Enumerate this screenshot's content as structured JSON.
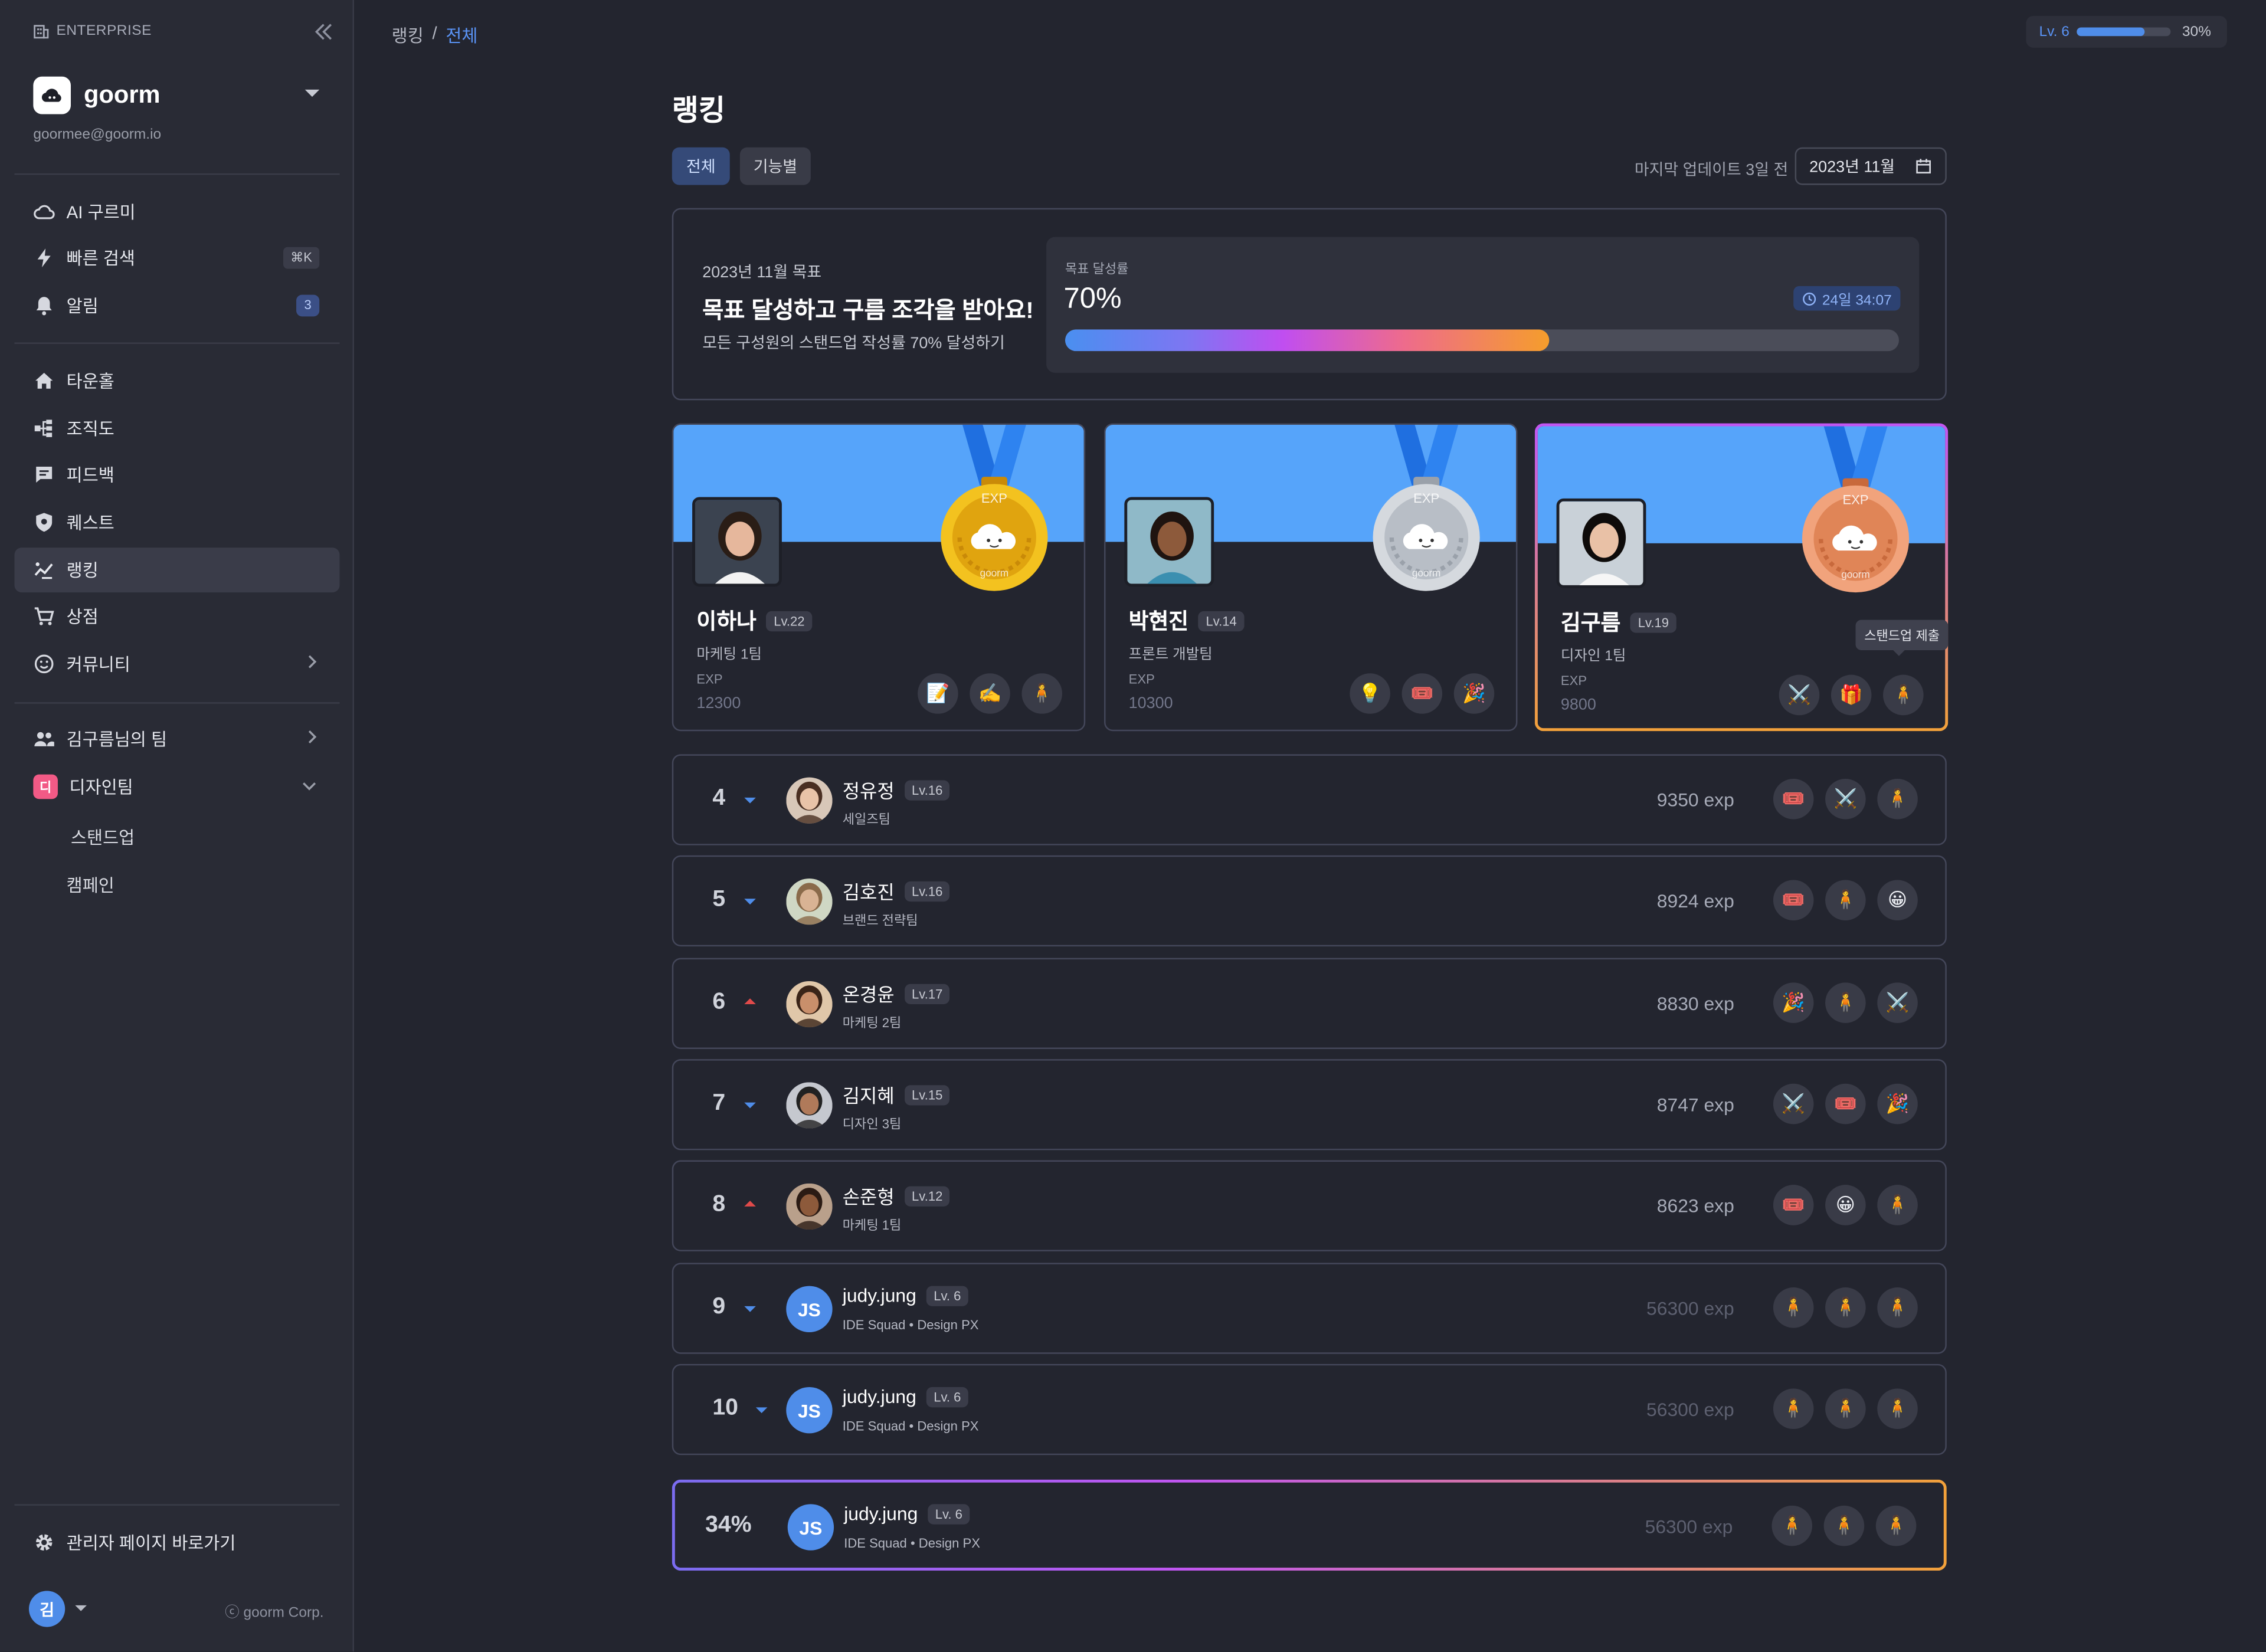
{
  "sidebar": {
    "enterprise": "ENTERPRISE",
    "org_name": "goorm",
    "org_email": "goormee@goorm.io",
    "nav": [
      {
        "label": "AI 구르미",
        "icon": "cloud-ai-icon"
      },
      {
        "label": "빠른 검색",
        "icon": "lightning-icon",
        "shortcut": "⌘K"
      },
      {
        "label": "알림",
        "icon": "bell-icon",
        "count": "3"
      },
      {
        "label": "타운홀",
        "icon": "home-icon"
      },
      {
        "label": "조직도",
        "icon": "org-chart-icon"
      },
      {
        "label": "피드백",
        "icon": "chat-icon"
      },
      {
        "label": "퀘스트",
        "icon": "shield-icon"
      },
      {
        "label": "랭킹",
        "icon": "ranking-icon"
      },
      {
        "label": "상점",
        "icon": "cart-icon"
      },
      {
        "label": "커뮤니티",
        "icon": "smile-icon"
      }
    ],
    "team_link": "김구름님의 팀",
    "design_team": {
      "badge": "디",
      "label": "디자인팀",
      "children": [
        "스탠드업",
        "캠페인"
      ]
    },
    "admin_link": "관리자 페이지 바로가기",
    "user_initial": "김",
    "corp": "ⓒ goorm Corp."
  },
  "header": {
    "breadcrumb": [
      "랭킹",
      "/",
      "전체"
    ],
    "level_label": "Lv. 6",
    "level_progress": 0.3,
    "level_pct": "30%"
  },
  "main": {
    "title": "랭킹",
    "tabs": [
      "전체",
      "기능별"
    ],
    "updated": "마지막 업데이트 3일 전",
    "month": "2023년 11월"
  },
  "goal": {
    "month_label": "2023년 11월 목표",
    "title": "목표 달성하고 구름 조각을 받아요!",
    "desc": "모든 구성원의 스탠드업 작성률 70% 달성하기",
    "rate_label": "목표 달성률",
    "rate": "70%",
    "rate_value": 0.58,
    "remaining": "24일 34:07"
  },
  "podium": [
    {
      "name": "이하나",
      "lv": "Lv.22",
      "team": "마케팅 1팀",
      "exp_label": "EXP",
      "exp": "12300",
      "medal": "gold",
      "medal_text": "EXP",
      "medal_brand": "goorm",
      "badges": [
        "📝",
        "✍️",
        "🧍"
      ]
    },
    {
      "name": "박현진",
      "lv": "Lv.14",
      "team": "프론트 개발팀",
      "exp_label": "EXP",
      "exp": "10300",
      "medal": "silver",
      "medal_text": "EXP",
      "medal_brand": "goorm",
      "badges": [
        "💡",
        "🎟️",
        "🎉"
      ]
    },
    {
      "name": "김구름",
      "lv": "Lv.19",
      "team": "디자인 1팀",
      "exp_label": "EXP",
      "exp": "9800",
      "medal": "bronze",
      "medal_text": "EXP",
      "medal_brand": "goorm",
      "badges": [
        "⚔️",
        "🎁",
        "🧍"
      ]
    }
  ],
  "tooltip": "스탠드업 제출",
  "rows": [
    {
      "rank": "4",
      "trend": "down",
      "name": "정유정",
      "lv": "Lv.16",
      "team": "세일즈팀",
      "exp": "9350 exp",
      "badges": [
        "🎟️",
        "⚔️",
        "🧍"
      ]
    },
    {
      "rank": "5",
      "trend": "down",
      "name": "김호진",
      "lv": "Lv.16",
      "team": "브랜드 전략팀",
      "exp": "8924 exp",
      "badges": [
        "🎟️",
        "🧍",
        "😀"
      ]
    },
    {
      "rank": "6",
      "trend": "up",
      "name": "온경윤",
      "lv": "Lv.17",
      "team": "마케팅 2팀",
      "exp": "8830 exp",
      "badges": [
        "🎉",
        "🧍",
        "⚔️"
      ]
    },
    {
      "rank": "7",
      "trend": "down",
      "name": "김지혜",
      "lv": "Lv.15",
      "team": "디자인 3팀",
      "exp": "8747 exp",
      "badges": [
        "⚔️",
        "🎟️",
        "🎉"
      ]
    },
    {
      "rank": "8",
      "trend": "up",
      "name": "손준형",
      "lv": "Lv.12",
      "team": "마케팅 1팀",
      "exp": "8623 exp",
      "badges": [
        "🎟️",
        "😀",
        "🧍"
      ]
    },
    {
      "rank": "9",
      "trend": "down",
      "name": "judy.jung",
      "lv": "Lv. 6",
      "team": "IDE Squad • Design PX",
      "exp": "56300 exp",
      "initials": "JS",
      "badges": [
        "🧍",
        "🧍",
        "🧍"
      ]
    },
    {
      "rank": "10",
      "trend": "down",
      "name": "judy.jung",
      "lv": "Lv. 6",
      "team": "IDE Squad • Design PX",
      "exp": "56300 exp",
      "initials": "JS",
      "badges": [
        "🧍",
        "🧍",
        "🧍"
      ]
    }
  ],
  "my_row": {
    "rank": "34%",
    "name": "judy.jung",
    "lv": "Lv. 6",
    "team": "IDE Squad • Design PX",
    "exp": "56300 exp",
    "initials": "JS",
    "badges": [
      "🧍",
      "🧍",
      "🧍"
    ]
  }
}
